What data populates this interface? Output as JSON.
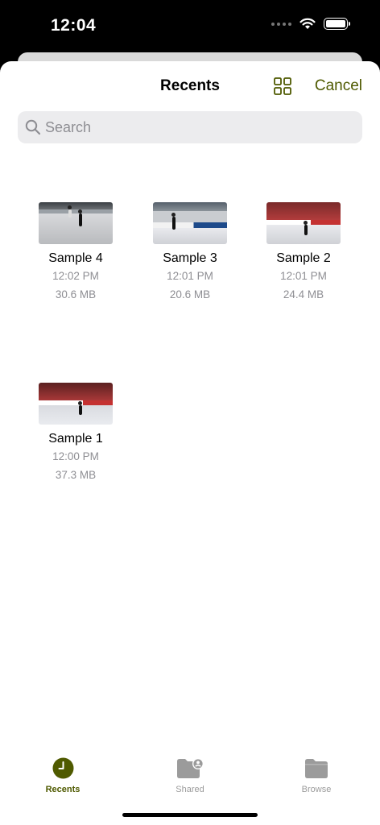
{
  "status": {
    "time": "12:04"
  },
  "header": {
    "title": "Recents",
    "cancel_label": "Cancel",
    "grid_icon": "grid-icon"
  },
  "search": {
    "placeholder": "Search",
    "value": ""
  },
  "files": [
    {
      "name": "Sample 4",
      "time": "12:02 PM",
      "size": "30.6 MB"
    },
    {
      "name": "Sample 3",
      "time": "12:01 PM",
      "size": "20.6 MB"
    },
    {
      "name": "Sample 2",
      "time": "12:01 PM",
      "size": "24.4 MB"
    },
    {
      "name": "Sample 1",
      "time": "12:00 PM",
      "size": "37.3 MB"
    }
  ],
  "tabs": [
    {
      "label": "Recents",
      "icon": "clock-icon",
      "active": true
    },
    {
      "label": "Shared",
      "icon": "shared-folder-icon",
      "active": false
    },
    {
      "label": "Browse",
      "icon": "folder-icon",
      "active": false
    }
  ],
  "colors": {
    "accent": "#4f5a00",
    "inactive": "#9b9b9b"
  }
}
